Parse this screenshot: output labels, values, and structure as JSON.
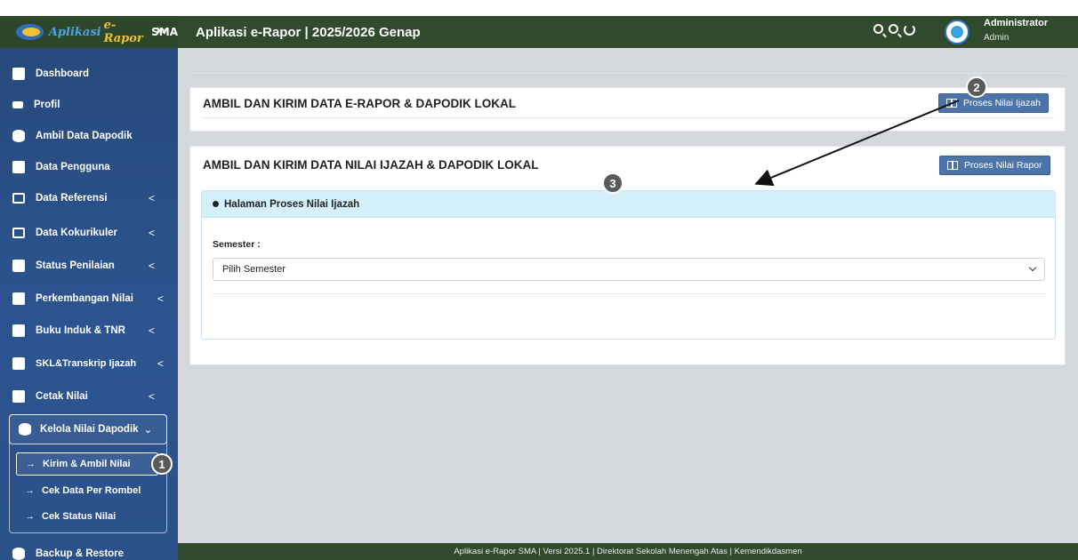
{
  "header": {
    "brand_part1": "Aplikasi",
    "brand_part2": "e-Rapor",
    "brand_part3": "SMA",
    "toggle": "⏵⏸",
    "title": "Aplikasi e-Rapor | 2025/2026 Genap",
    "user_name": "Administrator",
    "user_role": "Admin"
  },
  "sidebar": {
    "items": [
      {
        "label": "Dashboard",
        "icon": "dashboard-icon"
      },
      {
        "label": "Profil",
        "icon": "id-card-icon"
      },
      {
        "label": "Ambil Data Dapodik",
        "icon": "database-icon"
      },
      {
        "label": "Data Pengguna",
        "icon": "users-icon"
      },
      {
        "label": "Data Referensi",
        "icon": "monitor-icon",
        "caret": "<"
      },
      {
        "label": "Data Kokurikuler",
        "icon": "book-icon",
        "caret": "<"
      },
      {
        "label": "Status Penilaian",
        "icon": "chart-icon",
        "caret": "<"
      },
      {
        "label": "Perkembangan Nilai",
        "icon": "bar-chart-icon",
        "caret": "<"
      },
      {
        "label": "Buku Induk & TNR",
        "icon": "ledger-icon",
        "caret": "<"
      },
      {
        "label": "SKL&Transkrip Ijazah",
        "icon": "file-icon",
        "caret": "<"
      },
      {
        "label": "Cetak Nilai",
        "icon": "printer-icon",
        "caret": "<"
      }
    ],
    "group": {
      "label": "Kelola Nilai Dapodik",
      "caret": "⌄"
    },
    "sub_items": [
      {
        "label": "Kirim & Ambil Nilai",
        "arrow": "→"
      },
      {
        "label": "Cek Data Per Rombel",
        "arrow": "→"
      },
      {
        "label": "Cek Status Nilai",
        "arrow": "→"
      }
    ],
    "bottom_item": {
      "label": "Backup & Restore",
      "icon": "database-icon"
    }
  },
  "main": {
    "card1": {
      "title": "AMBIL DAN KIRIM DATA E-RAPOR & DAPODIK LOKAL",
      "button": "Proses Nilai Ijazah"
    },
    "card2": {
      "title": "AMBIL DAN KIRIM DATA NILAI IJAZAH & DAPODIK LOKAL",
      "button": "Proses Nilai Rapor",
      "panel_title": "Halaman Proses Nilai Ijazah",
      "semester_label": "Semester :",
      "semester_value": "Pilih Semester"
    }
  },
  "annotations": {
    "n1": "1",
    "n2": "2",
    "n3": "3"
  },
  "footer": {
    "text": "Aplikasi e-Rapor SMA | Versi 2025.1 | Direktorat Sekolah Menengah Atas | Kemendikdasmen"
  },
  "colors": {
    "header": "#2f4a2c",
    "sidebar": "#2d5490",
    "button": "#4c74a8",
    "panel_head": "#d4f1fb"
  }
}
